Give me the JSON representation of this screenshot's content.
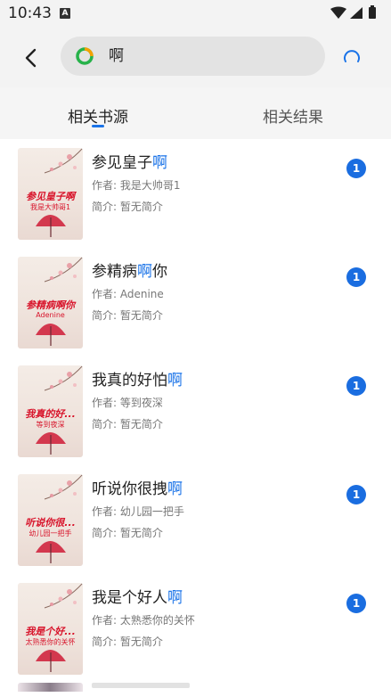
{
  "status": {
    "time": "10:43",
    "notification_icon": "A"
  },
  "header": {
    "back_icon": "chevron-left-icon",
    "search_query": "啊",
    "refresh_icon": "refresh-icon"
  },
  "tabs": [
    {
      "label": "相关书源",
      "active": true
    },
    {
      "label": "相关结果",
      "active": false
    }
  ],
  "books": [
    {
      "title_prefix": "参见皇子",
      "title_highlight": "啊",
      "title_suffix": "",
      "author": "作者: 我是大帅哥1",
      "intro": "简介: 暂无简介",
      "cover_title": "参见皇子啊",
      "cover_author": "我是大帅哥1",
      "count": "1"
    },
    {
      "title_prefix": "参精病",
      "title_highlight": "啊",
      "title_suffix": "你",
      "author": "作者: Adenine",
      "intro": "简介: 暂无简介",
      "cover_title": "参精病啊你",
      "cover_author": "Adenine",
      "count": "1"
    },
    {
      "title_prefix": "我真的好怕",
      "title_highlight": "啊",
      "title_suffix": "",
      "author": "作者: 等到夜深",
      "intro": "简介: 暂无简介",
      "cover_title": "我真的好...",
      "cover_author": "等到夜深",
      "count": "1"
    },
    {
      "title_prefix": "听说你很拽",
      "title_highlight": "啊",
      "title_suffix": "",
      "author": "作者: 幼儿园一把手",
      "intro": "简介: 暂无简介",
      "cover_title": "听说你很...",
      "cover_author": "幼儿园一把手",
      "count": "1"
    },
    {
      "title_prefix": "我是个好人",
      "title_highlight": "啊",
      "title_suffix": "",
      "author": "作者: 太熟悉你的关怀",
      "intro": "简介: 暂无简介",
      "cover_title": "我是个好...",
      "cover_author": "太熟悉你的关怀",
      "count": "1"
    }
  ],
  "colors": {
    "accent": "#1a73e8",
    "badge": "#1a6de0",
    "cover_text": "#d8142b"
  }
}
